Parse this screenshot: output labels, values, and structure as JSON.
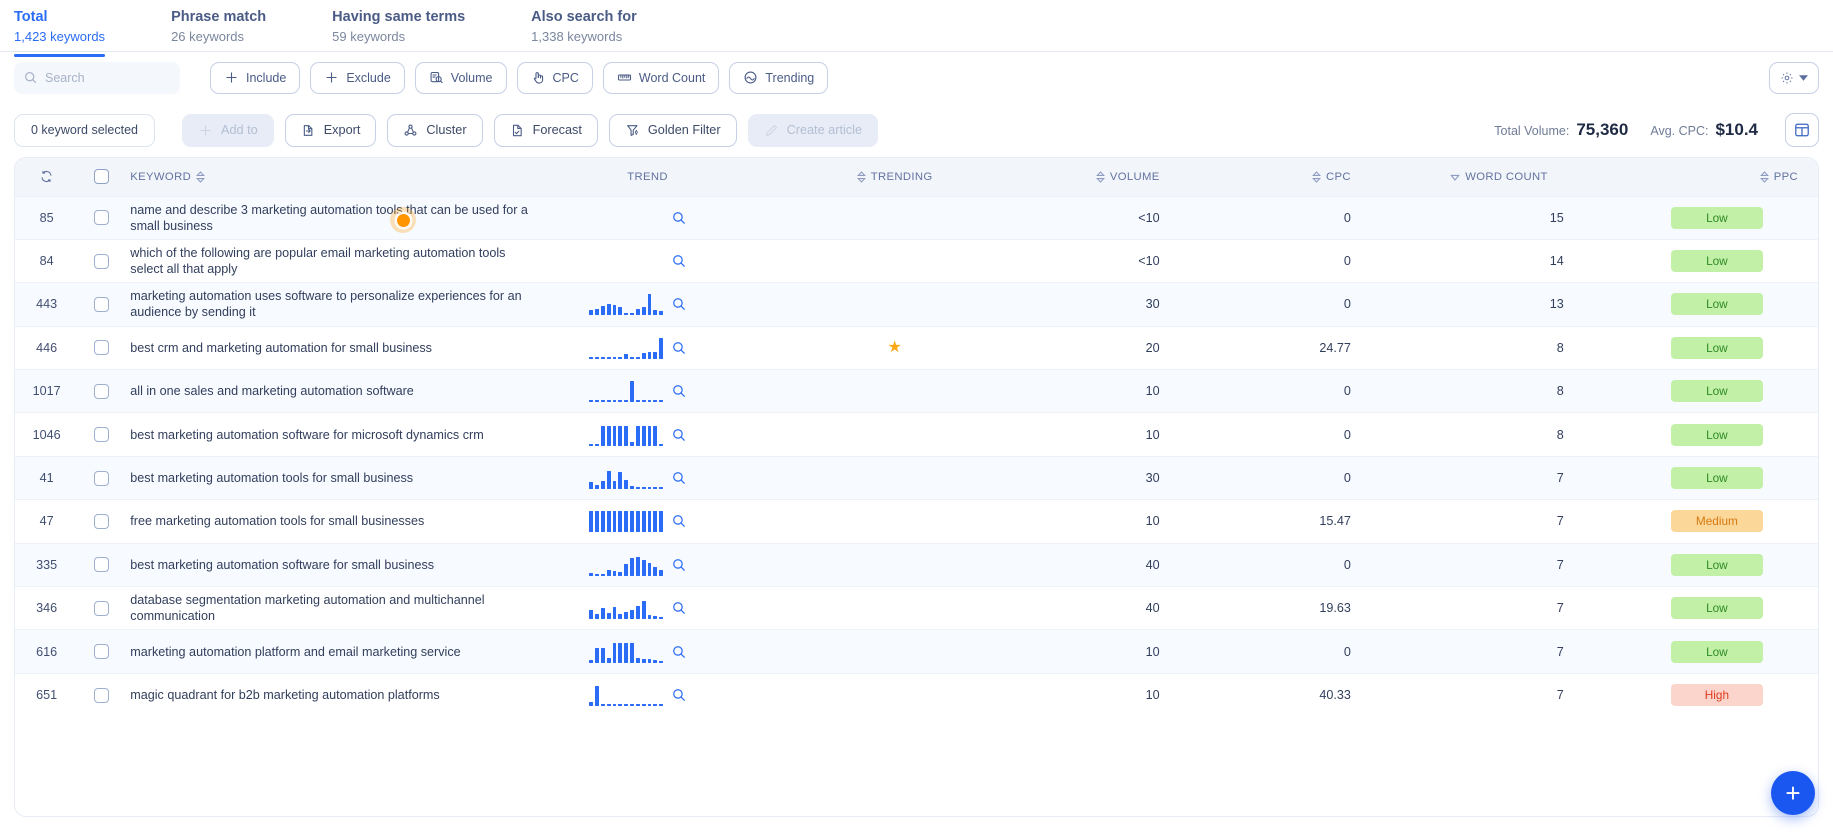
{
  "tabs": [
    {
      "label": "Total",
      "count": "1,423 keywords",
      "active": true
    },
    {
      "label": "Phrase match",
      "count": "26 keywords",
      "active": false
    },
    {
      "label": "Having same terms",
      "count": "59 keywords",
      "active": false
    },
    {
      "label": "Also search for",
      "count": "1,338 keywords",
      "active": false
    }
  ],
  "search": {
    "placeholder": "Search",
    "value": ""
  },
  "filters": [
    {
      "label": "Include",
      "icon": "plus-icon"
    },
    {
      "label": "Exclude",
      "icon": "plus-icon"
    },
    {
      "label": "Volume",
      "icon": "volume-search-icon"
    },
    {
      "label": "CPC",
      "icon": "click-hand-icon"
    },
    {
      "label": "Word Count",
      "icon": "ruler-icon"
    },
    {
      "label": "Trending",
      "icon": "trending-icon"
    }
  ],
  "settings_button": {
    "name": "settings-dropdown",
    "icon": "gear-icon"
  },
  "actions": {
    "selection_label": "0 keyword selected",
    "buttons": [
      {
        "label": "Add to",
        "icon": "plus-icon",
        "disabled": true
      },
      {
        "label": "Export",
        "icon": "export-icon",
        "disabled": false
      },
      {
        "label": "Cluster",
        "icon": "cluster-icon",
        "disabled": false
      },
      {
        "label": "Forecast",
        "icon": "forecast-icon",
        "disabled": false
      },
      {
        "label": "Golden Filter",
        "icon": "golden-filter-icon",
        "disabled": false
      },
      {
        "label": "Create article",
        "icon": "pencil-icon",
        "disabled": true
      }
    ]
  },
  "stats": {
    "total_volume_label": "Total Volume:",
    "total_volume_value": "75,360",
    "avg_cpc_label": "Avg. CPC:",
    "avg_cpc_value": "$10.4",
    "layout_button": "layout-toggle"
  },
  "table": {
    "columns": [
      {
        "key": "refresh",
        "label": "",
        "sortable": false
      },
      {
        "key": "select",
        "label": "",
        "sortable": false
      },
      {
        "key": "keyword",
        "label": "KEYWORD",
        "sortable": true
      },
      {
        "key": "trend",
        "label": "TREND",
        "sortable": false
      },
      {
        "key": "trending",
        "label": "TRENDING",
        "sortable": true
      },
      {
        "key": "volume",
        "label": "VOLUME",
        "sortable": true
      },
      {
        "key": "cpc",
        "label": "CPC",
        "sortable": true
      },
      {
        "key": "wordcount",
        "label": "WORD COUNT",
        "sortable": true,
        "sorted": "desc"
      },
      {
        "key": "ppc",
        "label": "PPC",
        "sortable": true
      }
    ],
    "rows": [
      {
        "id": "85",
        "keyword": "name and describe 3 marketing automation tools that can be used for a small business",
        "trend": [],
        "trending": false,
        "volume": "<10",
        "cpc": "0",
        "word_count": "15",
        "ppc": "Low"
      },
      {
        "id": "84",
        "keyword": "which of the following are popular email marketing automation tools select all that apply",
        "trend": [],
        "trending": false,
        "volume": "<10",
        "cpc": "0",
        "word_count": "14",
        "ppc": "Low"
      },
      {
        "id": "443",
        "keyword": "marketing automation uses software to personalize experiences for an audience by sending it",
        "trend": [
          25,
          28,
          45,
          52,
          48,
          38,
          10,
          8,
          30,
          36,
          100,
          22,
          20
        ],
        "trending": false,
        "volume": "30",
        "cpc": "0",
        "word_count": "13",
        "ppc": "Low"
      },
      {
        "id": "446",
        "keyword": "best crm and marketing automation for small business",
        "trend": [
          8,
          8,
          8,
          8,
          8,
          8,
          25,
          8,
          8,
          28,
          35,
          35,
          100
        ],
        "trending": true,
        "volume": "20",
        "cpc": "24.77",
        "word_count": "8",
        "ppc": "Low"
      },
      {
        "id": "1017",
        "keyword": "all in one sales and marketing automation software",
        "trend": [
          8,
          8,
          8,
          8,
          8,
          8,
          8,
          100,
          8,
          8,
          8,
          8,
          8
        ],
        "trending": false,
        "volume": "10",
        "cpc": "0",
        "word_count": "8",
        "ppc": "Low"
      },
      {
        "id": "1046",
        "keyword": "best marketing automation software for microsoft dynamics crm",
        "trend": [
          10,
          10,
          95,
          95,
          95,
          95,
          95,
          20,
          95,
          95,
          95,
          95,
          8
        ],
        "trending": false,
        "volume": "10",
        "cpc": "0",
        "word_count": "8",
        "ppc": "Low"
      },
      {
        "id": "41",
        "keyword": "best marketing automation tools for small business",
        "trend": [
          35,
          20,
          40,
          85,
          40,
          80,
          45,
          15,
          10,
          10,
          8,
          8,
          8
        ],
        "trending": false,
        "volume": "30",
        "cpc": "0",
        "word_count": "7",
        "ppc": "Low"
      },
      {
        "id": "47",
        "keyword": "free marketing automation tools for small businesses",
        "trend": [
          100,
          100,
          100,
          100,
          100,
          100,
          100,
          100,
          100,
          100,
          100,
          100,
          100
        ],
        "trending": false,
        "volume": "10",
        "cpc": "15.47",
        "word_count": "7",
        "ppc": "Medium"
      },
      {
        "id": "335",
        "keyword": "best marketing automation software for small business",
        "trend": [
          12,
          10,
          10,
          30,
          25,
          18,
          55,
          85,
          90,
          75,
          60,
          45,
          30
        ],
        "trending": false,
        "volume": "40",
        "cpc": "0",
        "word_count": "7",
        "ppc": "Low"
      },
      {
        "id": "346",
        "keyword": "database segmentation marketing automation and multichannel communication",
        "trend": [
          45,
          25,
          50,
          30,
          55,
          25,
          35,
          45,
          60,
          85,
          20,
          12,
          10
        ],
        "trending": false,
        "volume": "40",
        "cpc": "19.63",
        "word_count": "7",
        "ppc": "Low"
      },
      {
        "id": "616",
        "keyword": "marketing automation platform and email marketing service",
        "trend": [
          12,
          70,
          70,
          25,
          95,
          95,
          95,
          95,
          25,
          20,
          20,
          15,
          8
        ],
        "trending": false,
        "volume": "10",
        "cpc": "0",
        "word_count": "7",
        "ppc": "Low"
      },
      {
        "id": "651",
        "keyword": "magic quadrant for b2b marketing automation platforms",
        "trend": [
          18,
          95,
          10,
          8,
          8,
          8,
          8,
          8,
          8,
          8,
          8,
          8,
          8
        ],
        "trending": false,
        "volume": "10",
        "cpc": "40.33",
        "word_count": "7",
        "ppc": "High"
      }
    ]
  },
  "fab": {
    "label": "+",
    "name": "add-floating-button"
  },
  "colors": {
    "accent": "#2b6cf6",
    "low": "#c3f0a7",
    "medium": "#fcd79a",
    "high": "#fbd5cc",
    "star": "#fba917",
    "click_indicator": "#ff9500"
  }
}
